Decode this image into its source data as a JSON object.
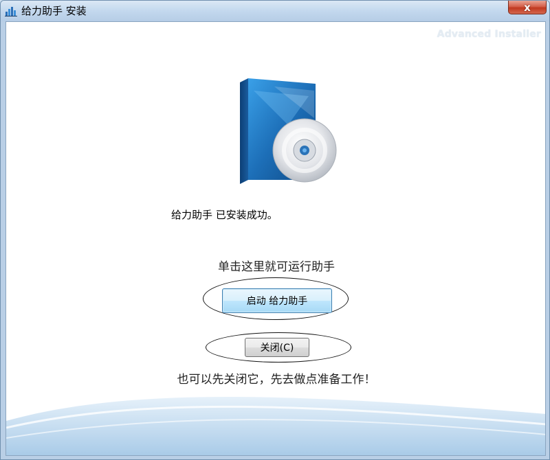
{
  "window": {
    "title": "给力助手 安装",
    "close_glyph": "x",
    "watermark": "Advanced Installer"
  },
  "content": {
    "success_message": "给力助手 已安装成功。",
    "hint": "单击这里就可运行助手",
    "launch_button": "启动 给力助手",
    "close_button": "关闭(C)",
    "footer_hint": "也可以先关闭它，先去做点准备工作！"
  },
  "icons": {
    "app": "app-chart-icon",
    "product": "software-box-cd-icon"
  },
  "colors": {
    "accent_blue": "#1f73b8",
    "close_red": "#c1381f",
    "title_bar": "#c3d8ee"
  }
}
